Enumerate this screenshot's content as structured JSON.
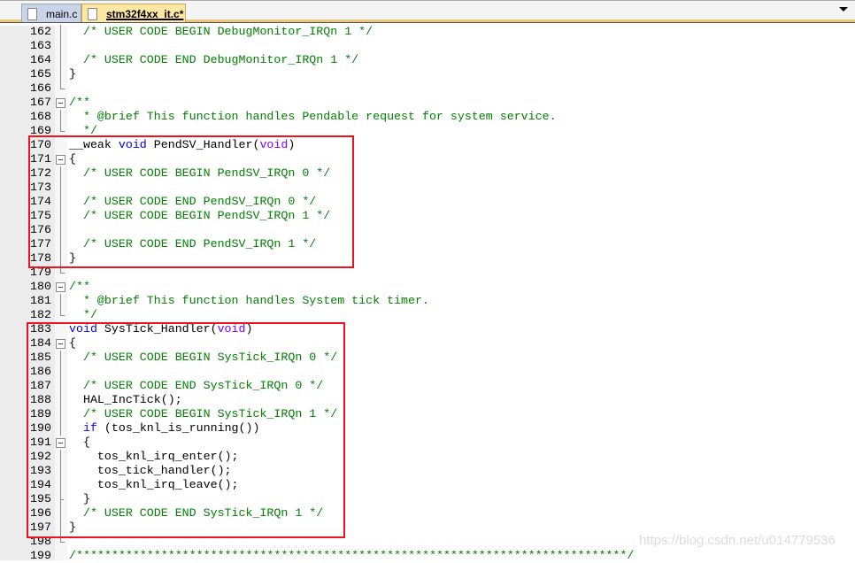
{
  "tabs": [
    {
      "label": "main.c",
      "active": false
    },
    {
      "label": "stm32f4xx_it.c*",
      "active": true
    }
  ],
  "colors": {
    "comment": "#008000",
    "keyword": "#0000ff",
    "type": "#8000ff",
    "highlight_box": "#e8141e"
  },
  "lines": [
    {
      "n": "162",
      "f": "v",
      "t": [
        [
          "c",
          "  /* USER CODE BEGIN DebugMonitor_IRQn 1 */"
        ]
      ]
    },
    {
      "n": "163",
      "f": "v",
      "t": []
    },
    {
      "n": "164",
      "f": "v",
      "t": [
        [
          "c",
          "  /* USER CODE END DebugMonitor_IRQn 1 */"
        ]
      ]
    },
    {
      "n": "165",
      "f": "v",
      "t": [
        [
          "p",
          "}"
        ]
      ]
    },
    {
      "n": "166",
      "f": "e",
      "t": []
    },
    {
      "n": "167",
      "f": "b",
      "t": [
        [
          "c",
          "/**"
        ]
      ]
    },
    {
      "n": "168",
      "f": "v",
      "t": [
        [
          "c",
          "  * @brief This function handles Pendable request for system service."
        ]
      ]
    },
    {
      "n": "169",
      "f": "e",
      "t": [
        [
          "c",
          "  */"
        ]
      ]
    },
    {
      "n": "170",
      "f": "",
      "t": [
        [
          "p",
          "__weak "
        ],
        [
          "k",
          "void"
        ],
        [
          "p",
          " PendSV_Handler("
        ],
        [
          "t",
          "void"
        ],
        [
          "p",
          ")"
        ]
      ]
    },
    {
      "n": "171",
      "f": "b",
      "t": [
        [
          "p",
          "{"
        ]
      ]
    },
    {
      "n": "172",
      "f": "v",
      "t": [
        [
          "c",
          "  /* USER CODE BEGIN PendSV_IRQn 0 */"
        ]
      ]
    },
    {
      "n": "173",
      "f": "v",
      "t": []
    },
    {
      "n": "174",
      "f": "v",
      "t": [
        [
          "c",
          "  /* USER CODE END PendSV_IRQn 0 */"
        ]
      ]
    },
    {
      "n": "175",
      "f": "v",
      "t": [
        [
          "c",
          "  /* USER CODE BEGIN PendSV_IRQn 1 */"
        ]
      ]
    },
    {
      "n": "176",
      "f": "v",
      "t": []
    },
    {
      "n": "177",
      "f": "v",
      "t": [
        [
          "c",
          "  /* USER CODE END PendSV_IRQn 1 */"
        ]
      ]
    },
    {
      "n": "178",
      "f": "v",
      "t": [
        [
          "p",
          "}"
        ]
      ]
    },
    {
      "n": "179",
      "f": "e",
      "t": []
    },
    {
      "n": "180",
      "f": "b",
      "t": [
        [
          "c",
          "/**"
        ]
      ]
    },
    {
      "n": "181",
      "f": "v",
      "t": [
        [
          "c",
          "  * @brief This function handles System tick timer."
        ]
      ]
    },
    {
      "n": "182",
      "f": "e",
      "t": [
        [
          "c",
          "  */"
        ]
      ]
    },
    {
      "n": "183",
      "f": "",
      "t": [
        [
          "k",
          "void"
        ],
        [
          "p",
          " SysTick_Handler("
        ],
        [
          "t",
          "void"
        ],
        [
          "p",
          ")"
        ]
      ]
    },
    {
      "n": "184",
      "f": "b",
      "t": [
        [
          "p",
          "{"
        ]
      ]
    },
    {
      "n": "185",
      "f": "v",
      "t": [
        [
          "c",
          "  /* USER CODE BEGIN SysTick_IRQn 0 */"
        ]
      ]
    },
    {
      "n": "186",
      "f": "v",
      "t": []
    },
    {
      "n": "187",
      "f": "v",
      "t": [
        [
          "c",
          "  /* USER CODE END SysTick_IRQn 0 */"
        ]
      ]
    },
    {
      "n": "188",
      "f": "v",
      "t": [
        [
          "p",
          "  HAL_IncTick();"
        ]
      ]
    },
    {
      "n": "189",
      "f": "v",
      "t": [
        [
          "c",
          "  /* USER CODE BEGIN SysTick_IRQn 1 */"
        ]
      ]
    },
    {
      "n": "190",
      "f": "v",
      "t": [
        [
          "p",
          "  "
        ],
        [
          "k",
          "if"
        ],
        [
          "p",
          " (tos_knl_is_running())"
        ]
      ]
    },
    {
      "n": "191",
      "f": "b",
      "t": [
        [
          "p",
          "  {"
        ]
      ]
    },
    {
      "n": "192",
      "f": "v",
      "t": [
        [
          "p",
          "    tos_knl_irq_enter();"
        ]
      ]
    },
    {
      "n": "193",
      "f": "v",
      "t": [
        [
          "p",
          "    tos_tick_handler();"
        ]
      ]
    },
    {
      "n": "194",
      "f": "v",
      "t": [
        [
          "p",
          "    tos_knl_irq_leave();"
        ]
      ]
    },
    {
      "n": "195",
      "f": "t",
      "t": [
        [
          "p",
          "  }"
        ]
      ]
    },
    {
      "n": "196",
      "f": "v",
      "t": [
        [
          "c",
          "  /* USER CODE END SysTick_IRQn 1 */"
        ]
      ]
    },
    {
      "n": "197",
      "f": "v",
      "t": [
        [
          "p",
          "}"
        ]
      ]
    },
    {
      "n": "198",
      "f": "e",
      "t": []
    },
    {
      "n": "199",
      "f": "",
      "t": [
        [
          "c",
          "/******************************************************************************/"
        ]
      ]
    }
  ],
  "watermark": "https://blog.csdn.net/u014779536"
}
